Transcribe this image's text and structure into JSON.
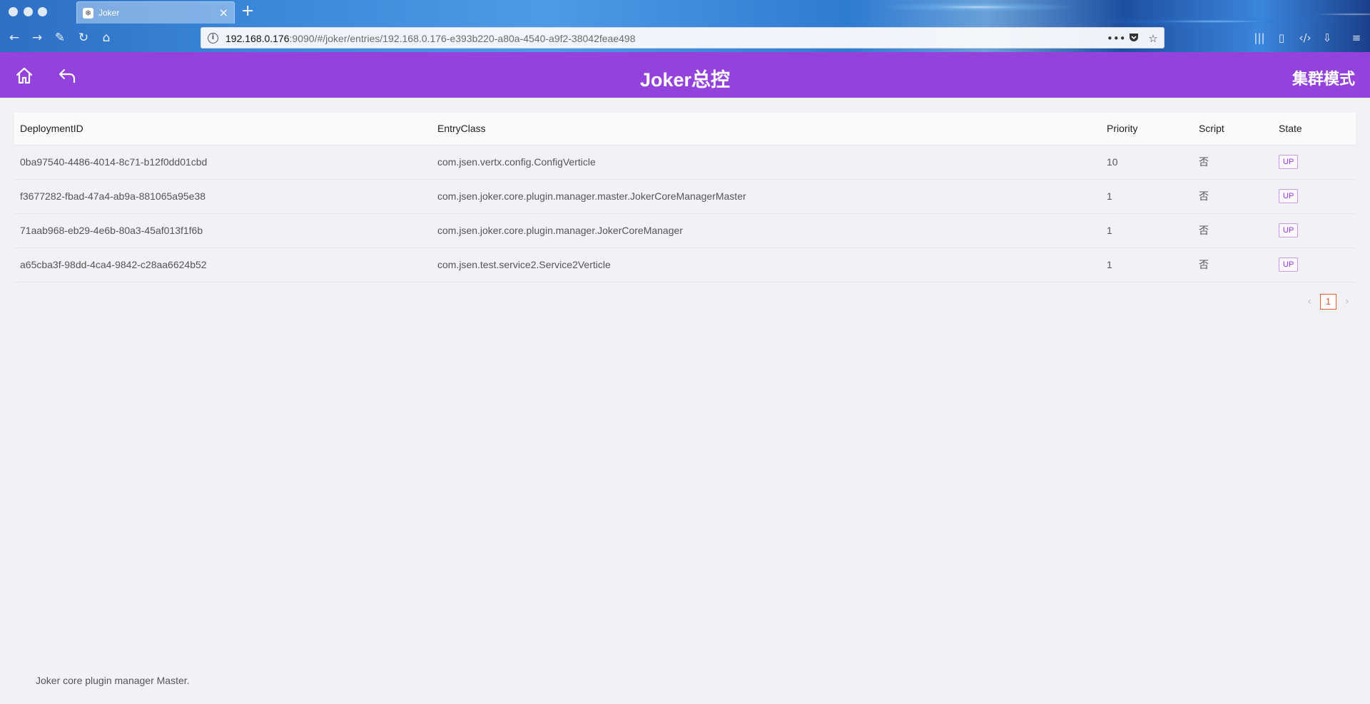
{
  "browser": {
    "tab_title": "Joker",
    "tab_favicon": "❄",
    "url_host": "192.168.0.176",
    "url_rest": ":9090/#/joker/entries/192.168.0.176-e393b220-a80a-4540-a9f2-38042feae498"
  },
  "header": {
    "title": "Joker总控",
    "mode_label": "集群模式",
    "home_icon": "home-icon",
    "back_icon": "back-arrow-icon",
    "color": "#9442dc"
  },
  "table": {
    "columns": [
      "DeploymentID",
      "EntryClass",
      "Priority",
      "Script",
      "State"
    ],
    "rows": [
      {
        "deployment_id": "0ba97540-4486-4014-8c71-b12f0dd01cbd",
        "entry_class": "com.jsen.vertx.config.ConfigVerticle",
        "priority": "10",
        "script": "否",
        "state": "UP"
      },
      {
        "deployment_id": "f3677282-fbad-47a4-ab9a-881065a95e38",
        "entry_class": "com.jsen.joker.core.plugin.manager.master.JokerCoreManagerMaster",
        "priority": "1",
        "script": "否",
        "state": "UP"
      },
      {
        "deployment_id": "71aab968-eb29-4e6b-80a3-45af013f1f6b",
        "entry_class": "com.jsen.joker.core.plugin.manager.JokerCoreManager",
        "priority": "1",
        "script": "否",
        "state": "UP"
      },
      {
        "deployment_id": "a65cba3f-98dd-4ca4-9842-c28aa6624b52",
        "entry_class": "com.jsen.test.service2.Service2Verticle",
        "priority": "1",
        "script": "否",
        "state": "UP"
      }
    ]
  },
  "pagination": {
    "prev": "‹",
    "current": "1",
    "next": "›"
  },
  "footer": {
    "text": "Joker core plugin manager Master."
  }
}
